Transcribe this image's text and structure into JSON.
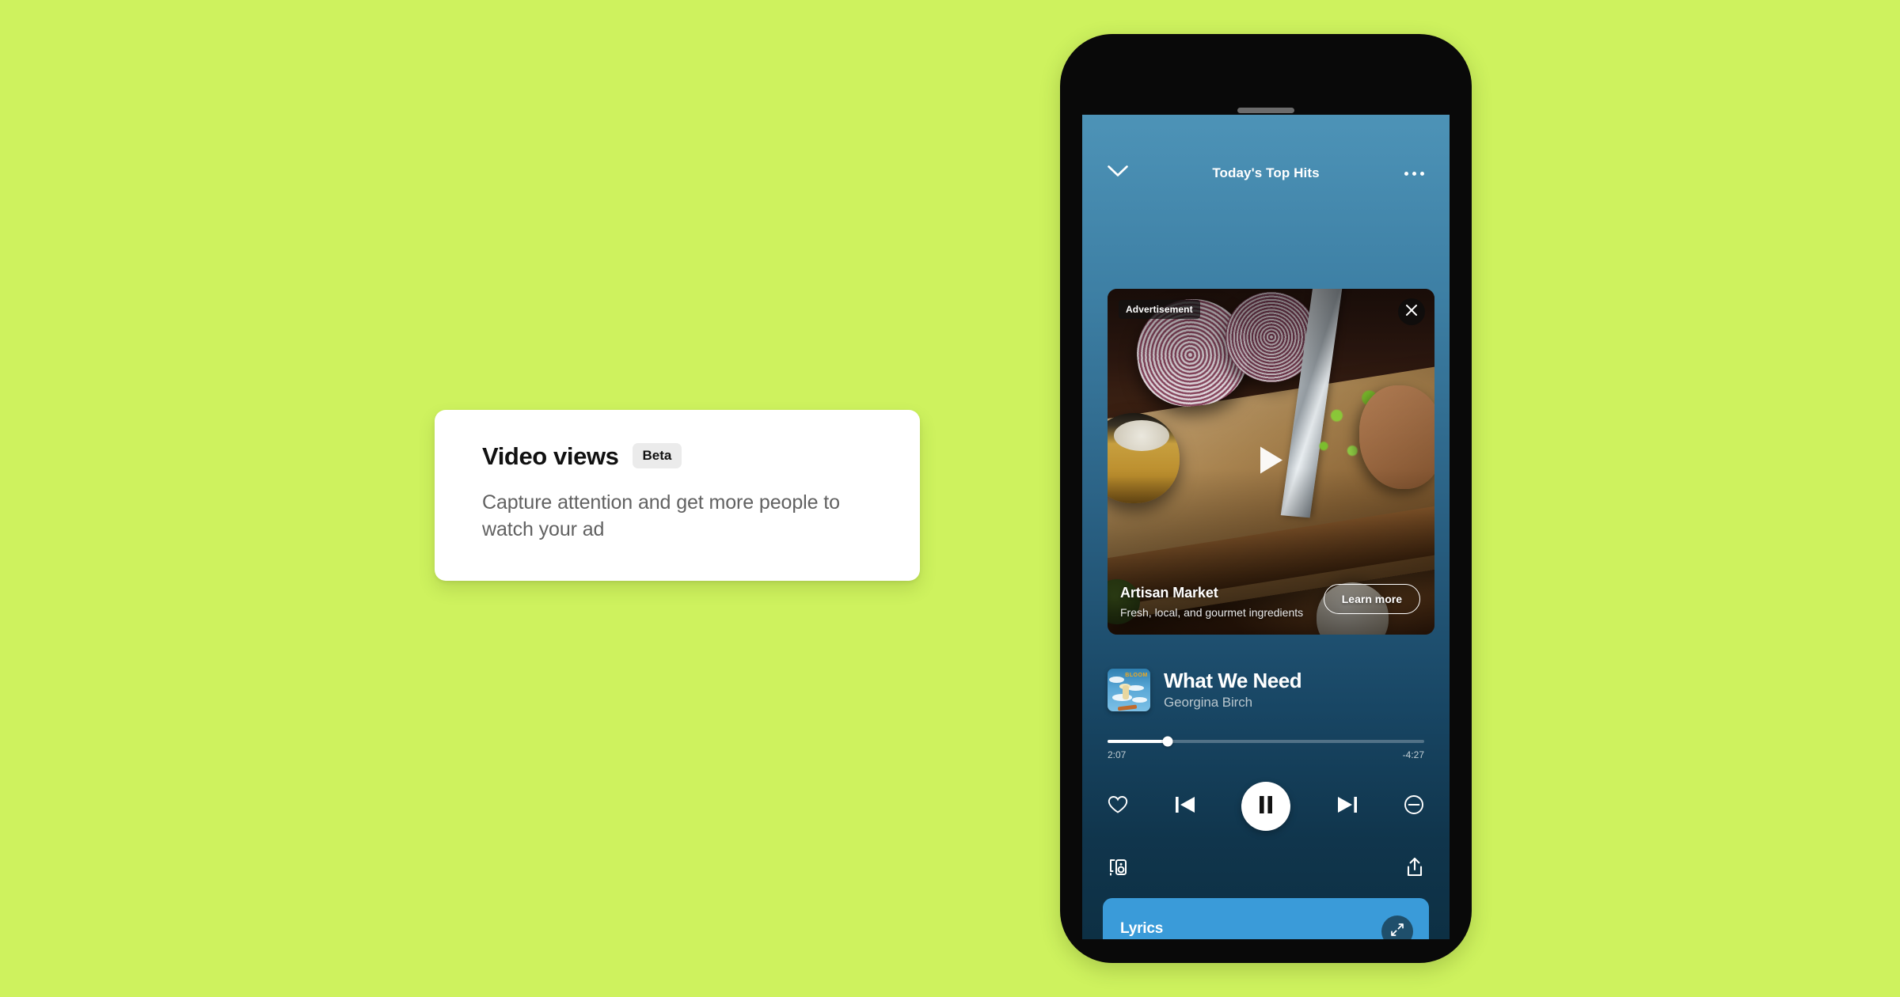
{
  "page": {
    "background_color": "#CEF25E"
  },
  "feature_card": {
    "title": "Video views",
    "badge": "Beta",
    "description": "Capture attention and get more people to watch your ad",
    "background_color": "#FFFFFF",
    "badge_background_color": "#EBEBEB",
    "title_color": "#111111",
    "description_color": "#616161"
  },
  "phone": {
    "frame_color": "#090909",
    "screen_gradient_top": "#4D93B7",
    "screen_gradient_bottom": "#0D3044",
    "speaker_icon": "speaker-slit"
  },
  "player": {
    "topbar": {
      "collapse_icon": "chevron-down-icon",
      "title": "Today's Top Hits",
      "more_icon": "more-options-icon"
    },
    "ad": {
      "label": "Advertisement",
      "close_icon": "close-icon",
      "play_icon": "play-icon",
      "brand": "Artisan Market",
      "tagline": "Fresh, local, and gourmet ingredients",
      "cta_label": "Learn more"
    },
    "track": {
      "title": "What We Need",
      "artist": "Georgina Birch",
      "album_art_text": "BLOOM",
      "album_art_alt": "album-artwork"
    },
    "progress": {
      "elapsed": "2:07",
      "remaining": "-4:27",
      "percent": 19
    },
    "controls": {
      "like_icon": "heart-icon",
      "previous_icon": "skip-previous-icon",
      "play_pause_icon": "pause-icon",
      "next_icon": "skip-next-icon",
      "hide_icon": "hide-song-icon"
    },
    "bottom": {
      "devices_icon": "connect-to-device-icon",
      "share_icon": "share-icon"
    },
    "lyrics": {
      "title": "Lyrics",
      "expand_icon": "expand-icon",
      "background_color": "#3A9BD9"
    }
  }
}
